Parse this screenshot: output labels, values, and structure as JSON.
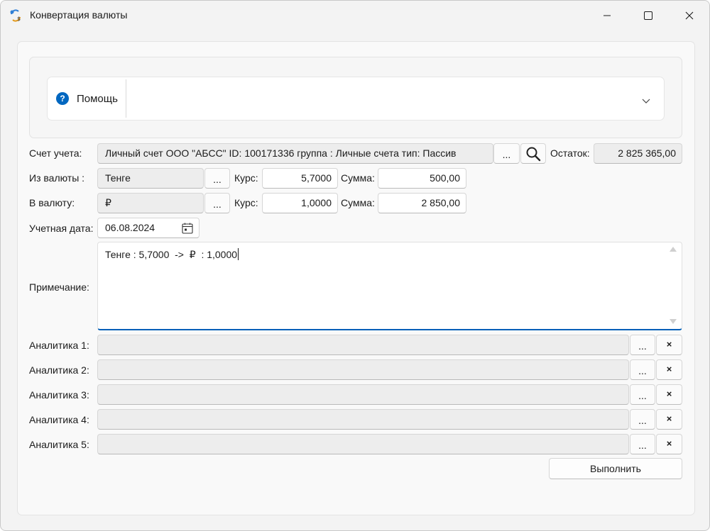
{
  "window": {
    "title": "Конвертация валюты",
    "icon": "currency-exchange-icon"
  },
  "help": {
    "label": "Помощь",
    "icon": "question-circle-icon"
  },
  "account": {
    "label": "Счет учета:",
    "value": "Личный счет ООО \"АБСС\" ID: 100171336 группа : Личные счета тип: Пассив",
    "browse_label": "...",
    "balance_label": "Остаток:",
    "balance_value": "2 825 365,00"
  },
  "from_currency": {
    "label": "Из валюты :",
    "value": "Тенге",
    "browse_label": "...",
    "rate_label": "Курс:",
    "rate_value": "5,7000",
    "sum_label": "Сумма:",
    "sum_value": "500,00"
  },
  "to_currency": {
    "label": "В валюту:",
    "value": "₽",
    "browse_label": "...",
    "rate_label": "Курс:",
    "rate_value": "1,0000",
    "sum_label": "Сумма:",
    "sum_value": "2 850,00"
  },
  "accounting_date": {
    "label": "Учетная дата:",
    "value": "06.08.2024"
  },
  "note": {
    "label": "Примечание:",
    "value": "Тенге : 5,7000  ->  ₽  : 1,0000"
  },
  "analytics": [
    {
      "label": "Аналитика 1:",
      "value": "",
      "browse_label": "...",
      "clear_label": "×"
    },
    {
      "label": "Аналитика 2:",
      "value": "",
      "browse_label": "...",
      "clear_label": "×"
    },
    {
      "label": "Аналитика 3:",
      "value": "",
      "browse_label": "...",
      "clear_label": "×"
    },
    {
      "label": "Аналитика 4:",
      "value": "",
      "browse_label": "...",
      "clear_label": "×"
    },
    {
      "label": "Аналитика 5:",
      "value": "",
      "browse_label": "...",
      "clear_label": "×"
    }
  ],
  "actions": {
    "run_label": "Выполнить"
  },
  "colors": {
    "accent": "#005fb8",
    "help_icon": "#0067c0"
  }
}
